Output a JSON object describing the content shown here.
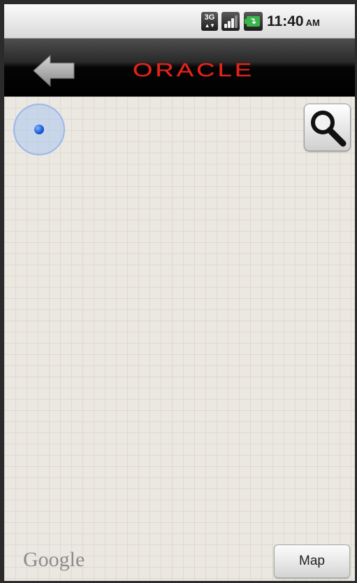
{
  "status_bar": {
    "network_label": "3G",
    "time": "11:40",
    "ampm": "AM",
    "icons": [
      "network-3g-icon",
      "signal-strength-icon",
      "battery-charging-icon"
    ]
  },
  "header": {
    "logo_text": "ORACLE",
    "logo_color": "#e2231a",
    "back_icon": "back-arrow-icon"
  },
  "map": {
    "attribution": "Google",
    "map_button_label": "Map",
    "search_icon": "magnifier-icon",
    "location_icon": "my-location-icon"
  }
}
